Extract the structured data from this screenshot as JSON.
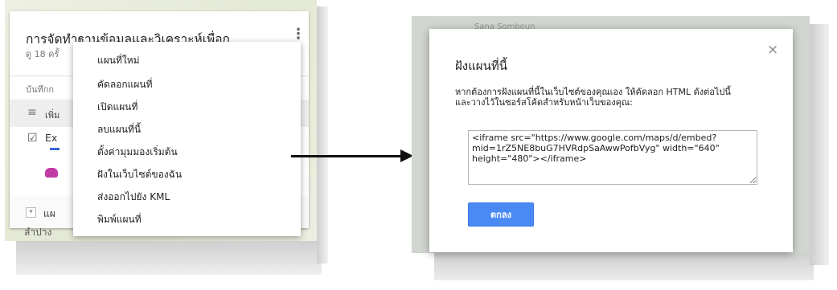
{
  "left": {
    "map_title": "การจัดทำฐานข้อมูลและวิเคราะห์เพื่อก..",
    "date_line": "ดู 18 ครั้",
    "saved_line": "บันทึกก",
    "add_layer_label": "เพิ่ม",
    "layer_name": "Ex",
    "basemap_label": "แผ",
    "map_town": "ลำปาง",
    "menu_items": [
      "แผนที่ใหม่",
      "คัดลอกแผนที่",
      "เปิดแผนที่",
      "ลบแผนที่นี้",
      "ตั้งค่ามุมมองเริ่มต้น",
      "ฝังในเว็บไซต์ของฉัน",
      "ส่งออกไปยัง KML",
      "พิมพ์แผนที่"
    ]
  },
  "right": {
    "map_label": "Sana Somboun",
    "dialog_title": "ฝังแผนที่นี้",
    "instructions": "หากต้องการฝังแผนที่นี้ในเว็บไซต์ของคุณเอง ให้คัดลอก HTML ดังต่อไปนี้และวางไว้ในซอร์สโค้ดสำหรับหน้าเว็บของคุณ:",
    "embed_code": "<iframe src=\"https://www.google.com/maps/d/embed?mid=1rZ5NE8buG7HVRdpSaAwwPofbVyg\" width=\"640\" height=\"480\"></iframe>",
    "ok_label": "ตกลง",
    "close_glyph": "×"
  },
  "icons": {
    "kebab": "⋮",
    "checkbox": "☑",
    "layers": "≡",
    "dropdown": "▾"
  },
  "colors": {
    "ok_button": "#4a8af4",
    "layer_line": "#3367d6",
    "marker": "#c23aa5"
  }
}
